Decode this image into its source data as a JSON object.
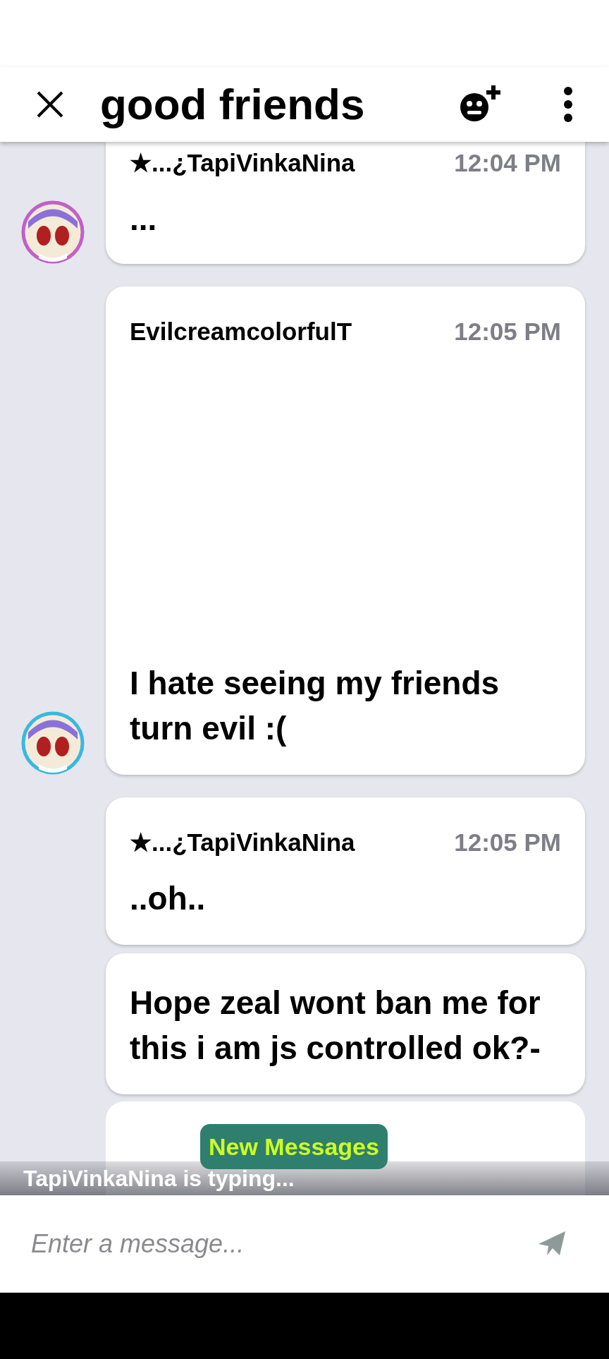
{
  "header": {
    "title": "good friends"
  },
  "messages": [
    {
      "sender": "★...¿TapiVinkaNina",
      "time": "12:04 PM",
      "text": "...",
      "avatar": {
        "color": "#c060c8"
      },
      "cut_top": true,
      "blank_space": false
    },
    {
      "sender": "EvilcreamcolorfulT",
      "time": "12:05 PM",
      "text": "I hate seeing my friends turn evil :(",
      "avatar": {
        "color": "#38b8e0"
      },
      "cut_top": false,
      "blank_space": true
    },
    {
      "sender": "★...¿TapiVinkaNina",
      "time": "12:05 PM",
      "text": "..oh..",
      "cut_top": false,
      "blank_space": false
    },
    {
      "text": "Hope zeal wont ban me for this i am js controlled ok?-",
      "cut_top": false,
      "blank_space": false
    }
  ],
  "new_messages_button": "New Messages",
  "typing_indicator": "TapiVinkaNina is typing...",
  "composer": {
    "placeholder": "Enter a message..."
  }
}
